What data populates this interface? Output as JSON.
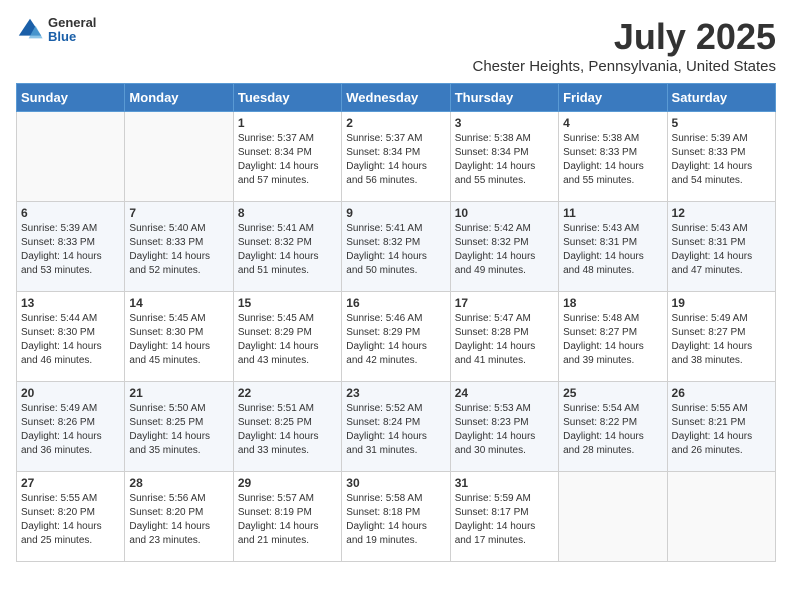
{
  "logo": {
    "general": "General",
    "blue": "Blue"
  },
  "title": "July 2025",
  "location": "Chester Heights, Pennsylvania, United States",
  "weekdays": [
    "Sunday",
    "Monday",
    "Tuesday",
    "Wednesday",
    "Thursday",
    "Friday",
    "Saturday"
  ],
  "weeks": [
    [
      {
        "day": "",
        "sunrise": "",
        "sunset": "",
        "daylight": ""
      },
      {
        "day": "",
        "sunrise": "",
        "sunset": "",
        "daylight": ""
      },
      {
        "day": "1",
        "sunrise": "Sunrise: 5:37 AM",
        "sunset": "Sunset: 8:34 PM",
        "daylight": "Daylight: 14 hours and 57 minutes."
      },
      {
        "day": "2",
        "sunrise": "Sunrise: 5:37 AM",
        "sunset": "Sunset: 8:34 PM",
        "daylight": "Daylight: 14 hours and 56 minutes."
      },
      {
        "day": "3",
        "sunrise": "Sunrise: 5:38 AM",
        "sunset": "Sunset: 8:34 PM",
        "daylight": "Daylight: 14 hours and 55 minutes."
      },
      {
        "day": "4",
        "sunrise": "Sunrise: 5:38 AM",
        "sunset": "Sunset: 8:33 PM",
        "daylight": "Daylight: 14 hours and 55 minutes."
      },
      {
        "day": "5",
        "sunrise": "Sunrise: 5:39 AM",
        "sunset": "Sunset: 8:33 PM",
        "daylight": "Daylight: 14 hours and 54 minutes."
      }
    ],
    [
      {
        "day": "6",
        "sunrise": "Sunrise: 5:39 AM",
        "sunset": "Sunset: 8:33 PM",
        "daylight": "Daylight: 14 hours and 53 minutes."
      },
      {
        "day": "7",
        "sunrise": "Sunrise: 5:40 AM",
        "sunset": "Sunset: 8:33 PM",
        "daylight": "Daylight: 14 hours and 52 minutes."
      },
      {
        "day": "8",
        "sunrise": "Sunrise: 5:41 AM",
        "sunset": "Sunset: 8:32 PM",
        "daylight": "Daylight: 14 hours and 51 minutes."
      },
      {
        "day": "9",
        "sunrise": "Sunrise: 5:41 AM",
        "sunset": "Sunset: 8:32 PM",
        "daylight": "Daylight: 14 hours and 50 minutes."
      },
      {
        "day": "10",
        "sunrise": "Sunrise: 5:42 AM",
        "sunset": "Sunset: 8:32 PM",
        "daylight": "Daylight: 14 hours and 49 minutes."
      },
      {
        "day": "11",
        "sunrise": "Sunrise: 5:43 AM",
        "sunset": "Sunset: 8:31 PM",
        "daylight": "Daylight: 14 hours and 48 minutes."
      },
      {
        "day": "12",
        "sunrise": "Sunrise: 5:43 AM",
        "sunset": "Sunset: 8:31 PM",
        "daylight": "Daylight: 14 hours and 47 minutes."
      }
    ],
    [
      {
        "day": "13",
        "sunrise": "Sunrise: 5:44 AM",
        "sunset": "Sunset: 8:30 PM",
        "daylight": "Daylight: 14 hours and 46 minutes."
      },
      {
        "day": "14",
        "sunrise": "Sunrise: 5:45 AM",
        "sunset": "Sunset: 8:30 PM",
        "daylight": "Daylight: 14 hours and 45 minutes."
      },
      {
        "day": "15",
        "sunrise": "Sunrise: 5:45 AM",
        "sunset": "Sunset: 8:29 PM",
        "daylight": "Daylight: 14 hours and 43 minutes."
      },
      {
        "day": "16",
        "sunrise": "Sunrise: 5:46 AM",
        "sunset": "Sunset: 8:29 PM",
        "daylight": "Daylight: 14 hours and 42 minutes."
      },
      {
        "day": "17",
        "sunrise": "Sunrise: 5:47 AM",
        "sunset": "Sunset: 8:28 PM",
        "daylight": "Daylight: 14 hours and 41 minutes."
      },
      {
        "day": "18",
        "sunrise": "Sunrise: 5:48 AM",
        "sunset": "Sunset: 8:27 PM",
        "daylight": "Daylight: 14 hours and 39 minutes."
      },
      {
        "day": "19",
        "sunrise": "Sunrise: 5:49 AM",
        "sunset": "Sunset: 8:27 PM",
        "daylight": "Daylight: 14 hours and 38 minutes."
      }
    ],
    [
      {
        "day": "20",
        "sunrise": "Sunrise: 5:49 AM",
        "sunset": "Sunset: 8:26 PM",
        "daylight": "Daylight: 14 hours and 36 minutes."
      },
      {
        "day": "21",
        "sunrise": "Sunrise: 5:50 AM",
        "sunset": "Sunset: 8:25 PM",
        "daylight": "Daylight: 14 hours and 35 minutes."
      },
      {
        "day": "22",
        "sunrise": "Sunrise: 5:51 AM",
        "sunset": "Sunset: 8:25 PM",
        "daylight": "Daylight: 14 hours and 33 minutes."
      },
      {
        "day": "23",
        "sunrise": "Sunrise: 5:52 AM",
        "sunset": "Sunset: 8:24 PM",
        "daylight": "Daylight: 14 hours and 31 minutes."
      },
      {
        "day": "24",
        "sunrise": "Sunrise: 5:53 AM",
        "sunset": "Sunset: 8:23 PM",
        "daylight": "Daylight: 14 hours and 30 minutes."
      },
      {
        "day": "25",
        "sunrise": "Sunrise: 5:54 AM",
        "sunset": "Sunset: 8:22 PM",
        "daylight": "Daylight: 14 hours and 28 minutes."
      },
      {
        "day": "26",
        "sunrise": "Sunrise: 5:55 AM",
        "sunset": "Sunset: 8:21 PM",
        "daylight": "Daylight: 14 hours and 26 minutes."
      }
    ],
    [
      {
        "day": "27",
        "sunrise": "Sunrise: 5:55 AM",
        "sunset": "Sunset: 8:20 PM",
        "daylight": "Daylight: 14 hours and 25 minutes."
      },
      {
        "day": "28",
        "sunrise": "Sunrise: 5:56 AM",
        "sunset": "Sunset: 8:20 PM",
        "daylight": "Daylight: 14 hours and 23 minutes."
      },
      {
        "day": "29",
        "sunrise": "Sunrise: 5:57 AM",
        "sunset": "Sunset: 8:19 PM",
        "daylight": "Daylight: 14 hours and 21 minutes."
      },
      {
        "day": "30",
        "sunrise": "Sunrise: 5:58 AM",
        "sunset": "Sunset: 8:18 PM",
        "daylight": "Daylight: 14 hours and 19 minutes."
      },
      {
        "day": "31",
        "sunrise": "Sunrise: 5:59 AM",
        "sunset": "Sunset: 8:17 PM",
        "daylight": "Daylight: 14 hours and 17 minutes."
      },
      {
        "day": "",
        "sunrise": "",
        "sunset": "",
        "daylight": ""
      },
      {
        "day": "",
        "sunrise": "",
        "sunset": "",
        "daylight": ""
      }
    ]
  ]
}
